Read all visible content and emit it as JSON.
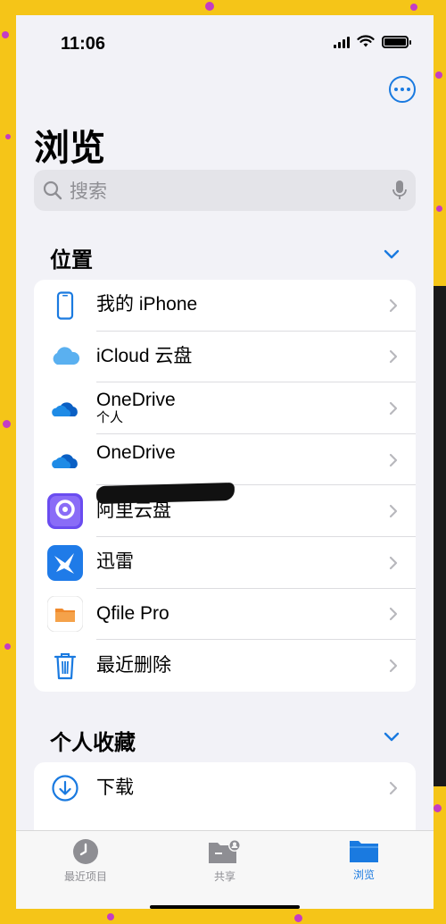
{
  "status_bar": {
    "time": "11:06"
  },
  "header": {
    "title": "浏览"
  },
  "search": {
    "placeholder": "搜索"
  },
  "locations": {
    "title": "位置",
    "items": [
      {
        "label": "我的 iPhone",
        "icon": "iphone-icon"
      },
      {
        "label": "iCloud 云盘",
        "icon": "icloud-icon"
      },
      {
        "label": "OneDrive",
        "sublabel": "个人",
        "icon": "onedrive-icon"
      },
      {
        "label": "OneDrive",
        "icon": "onedrive-icon"
      },
      {
        "label": "阿里云盘",
        "icon": "aliyun-drive-icon"
      },
      {
        "label": "迅雷",
        "icon": "xunlei-icon"
      },
      {
        "label": "Qfile Pro",
        "icon": "qfile-icon"
      },
      {
        "label": "最近删除",
        "icon": "trash-icon"
      }
    ]
  },
  "favorites": {
    "title": "个人收藏",
    "items": [
      {
        "label": "下载",
        "icon": "download-icon"
      }
    ]
  },
  "tab_bar": {
    "tabs": [
      {
        "label": "最近项目",
        "icon": "clock-icon",
        "active": false
      },
      {
        "label": "共享",
        "icon": "shared-folder-icon",
        "active": false
      },
      {
        "label": "浏览",
        "icon": "folder-icon",
        "active": true
      }
    ]
  },
  "colors": {
    "accent": "#1a7ae0",
    "background": "#f2f2f7",
    "frame": "#f5c518"
  }
}
